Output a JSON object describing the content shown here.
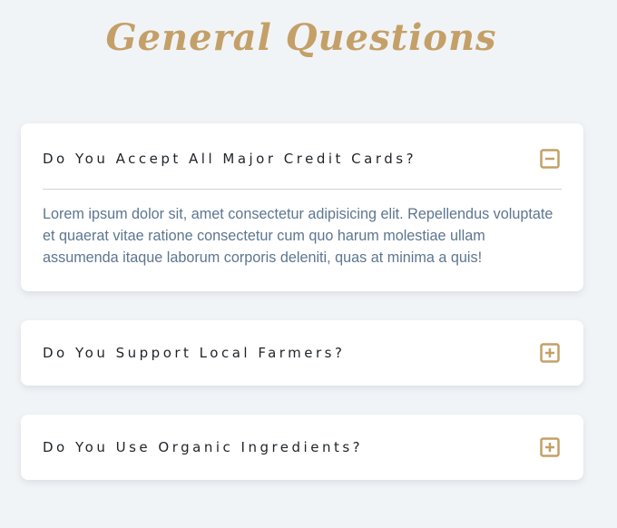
{
  "section": {
    "title": "General Questions"
  },
  "faq": [
    {
      "question": "Do You Accept All Major Credit Cards?",
      "answer": "Lorem ipsum dolor sit, amet consectetur adipisicing elit. Repellendus voluptate et quaerat vitae ratione consectetur cum quo harum molestiae ullam assumenda itaque laborum corporis deleniti, quas at minima a quis!",
      "expanded": true,
      "toggle_icon": "minus-square-icon"
    },
    {
      "question": "Do You Support Local Farmers?",
      "expanded": false,
      "toggle_icon": "plus-square-icon"
    },
    {
      "question": "Do You Use Organic Ingredients?",
      "expanded": false,
      "toggle_icon": "plus-square-icon"
    }
  ],
  "colors": {
    "background": "#f1f4f7",
    "accent": "#c4a068",
    "card": "#ffffff",
    "question_text": "#1f2429",
    "answer_text": "#5d7690"
  }
}
